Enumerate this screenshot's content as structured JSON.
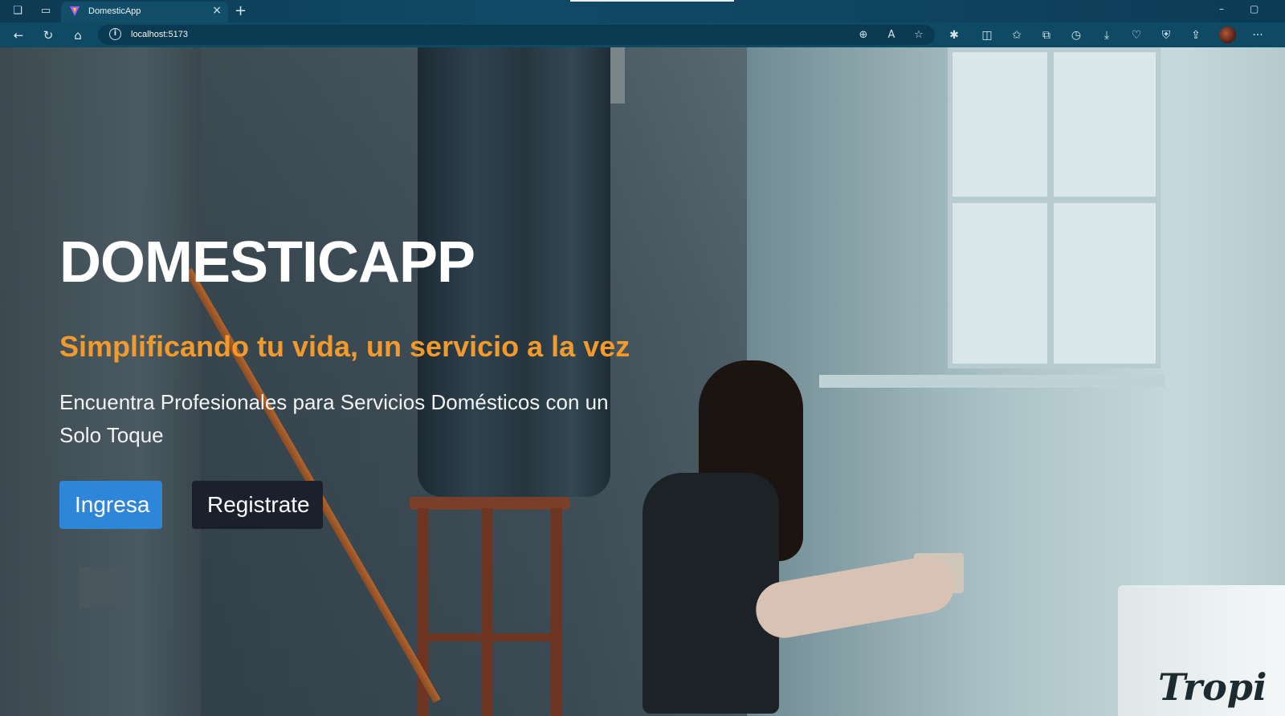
{
  "browser": {
    "tab_title": "DomesticApp",
    "tab_close": "×",
    "new_tab": "+",
    "url": "localhost:5173",
    "window_minimize": "–",
    "window_restore": "▢",
    "more": "···"
  },
  "hero": {
    "brand": "DOMESTICAPP",
    "tagline": "Simplificando tu vida, un servicio a la vez",
    "subtitle": "Encuentra Profesionales para Servicios Domésticos con un Solo Toque",
    "login_label": "Ingresa",
    "register_label": "Registrate",
    "bucket_text": "Tropi"
  },
  "colors": {
    "accent_orange": "#f29b2c",
    "primary_button": "#2f86d8",
    "dark_button": "#1c1f2c",
    "chrome": "#0f4a64"
  }
}
